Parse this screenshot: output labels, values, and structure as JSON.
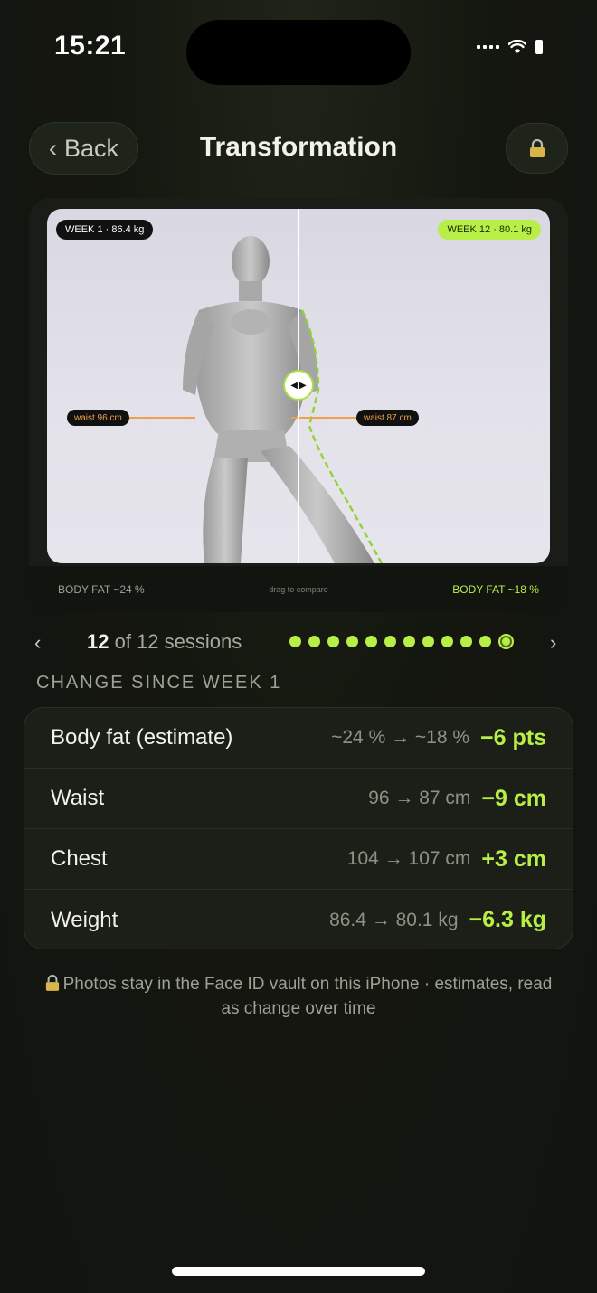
{
  "status": {
    "time": "15:21"
  },
  "nav": {
    "back_label": "Back",
    "title": "Transformation",
    "lock_icon": "lock-icon"
  },
  "compare": {
    "left_tag": "WEEK 1 · 86.4 kg",
    "right_tag": "WEEK 12 · 80.1 kg",
    "waist_left": "waist 96 cm",
    "waist_right": "waist 87 cm",
    "bodyfat_left": "BODY FAT ~24 %",
    "bodyfat_right": "BODY FAT ~18 %",
    "drag_hint": "drag to compare",
    "accent_color": "#b8ef47",
    "waist_color": "#f0a04a"
  },
  "sessions": {
    "current": "12",
    "rest": " of 12 sessions",
    "total": 12
  },
  "change": {
    "title": "CHANGE SINCE WEEK 1",
    "rows": [
      {
        "label": "Body fat (estimate)",
        "range": "~24 % → ~18 %",
        "delta": "−6 pts"
      },
      {
        "label": "Waist",
        "range": "96 → 87 cm",
        "delta": "−9 cm"
      },
      {
        "label": "Chest",
        "range": "104 → 107 cm",
        "delta": "+3 cm"
      },
      {
        "label": "Weight",
        "range": "86.4 → 80.1 kg",
        "delta": "−6.3 kg"
      }
    ]
  },
  "footnote": "Photos stay in the Face ID vault on this iPhone · estimates, read as change over time"
}
